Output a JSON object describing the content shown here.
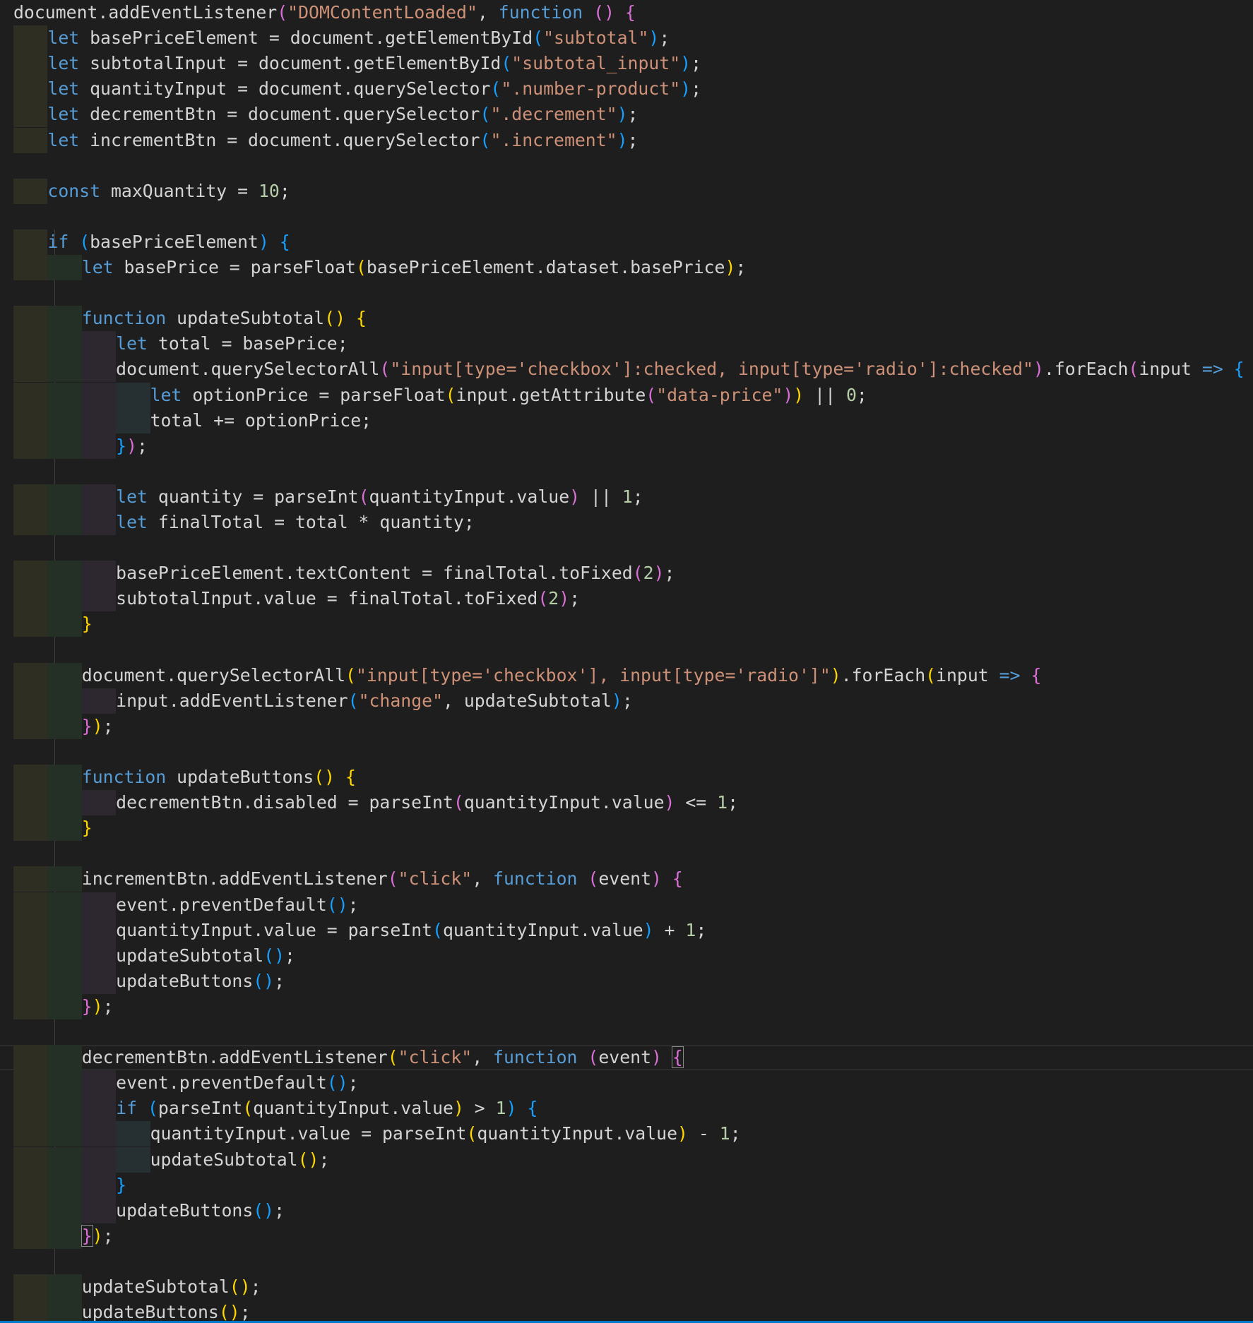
{
  "editor": {
    "language": "javascript",
    "current_line": 41,
    "lines": [
      {
        "indent": 0,
        "tokens": [
          [
            "plain",
            "document.addEventListener"
          ],
          [
            "bracket2",
            "("
          ],
          [
            "string",
            "\"DOMContentLoaded\""
          ],
          [
            "plain",
            ", "
          ],
          [
            "keyword",
            "function"
          ],
          [
            "plain",
            " "
          ],
          [
            "bracket2",
            "()"
          ],
          [
            "plain",
            " "
          ],
          [
            "bracket2",
            "{"
          ]
        ]
      },
      {
        "indent": 1,
        "tokens": [
          [
            "keyword",
            "let"
          ],
          [
            "plain",
            " basePriceElement = document.getElementById"
          ],
          [
            "bracket3",
            "("
          ],
          [
            "string",
            "\"subtotal\""
          ],
          [
            "bracket3",
            ")"
          ],
          [
            "plain",
            ";"
          ]
        ]
      },
      {
        "indent": 1,
        "tokens": [
          [
            "keyword",
            "let"
          ],
          [
            "plain",
            " subtotalInput = document.getElementById"
          ],
          [
            "bracket3",
            "("
          ],
          [
            "string",
            "\"subtotal_input\""
          ],
          [
            "bracket3",
            ")"
          ],
          [
            "plain",
            ";"
          ]
        ]
      },
      {
        "indent": 1,
        "tokens": [
          [
            "keyword",
            "let"
          ],
          [
            "plain",
            " quantityInput = document.querySelector"
          ],
          [
            "bracket3",
            "("
          ],
          [
            "string",
            "\".number-product\""
          ],
          [
            "bracket3",
            ")"
          ],
          [
            "plain",
            ";"
          ]
        ]
      },
      {
        "indent": 1,
        "tokens": [
          [
            "keyword",
            "let"
          ],
          [
            "plain",
            " decrementBtn = document.querySelector"
          ],
          [
            "bracket3",
            "("
          ],
          [
            "string",
            "\".decrement\""
          ],
          [
            "bracket3",
            ")"
          ],
          [
            "plain",
            ";"
          ]
        ]
      },
      {
        "indent": 1,
        "tokens": [
          [
            "keyword",
            "let"
          ],
          [
            "plain",
            " incrementBtn = document.querySelector"
          ],
          [
            "bracket3",
            "("
          ],
          [
            "string",
            "\".increment\""
          ],
          [
            "bracket3",
            ")"
          ],
          [
            "plain",
            ";"
          ]
        ]
      },
      {
        "indent": 0,
        "tokens": []
      },
      {
        "indent": 1,
        "tokens": [
          [
            "keyword",
            "const"
          ],
          [
            "plain",
            " maxQuantity = "
          ],
          [
            "number",
            "10"
          ],
          [
            "plain",
            ";"
          ]
        ]
      },
      {
        "indent": 0,
        "tokens": []
      },
      {
        "indent": 1,
        "tokens": [
          [
            "keyword",
            "if"
          ],
          [
            "plain",
            " "
          ],
          [
            "bracket3",
            "("
          ],
          [
            "plain",
            "basePriceElement"
          ],
          [
            "bracket3",
            ")"
          ],
          [
            "plain",
            " "
          ],
          [
            "bracket3",
            "{"
          ]
        ]
      },
      {
        "indent": 2,
        "tokens": [
          [
            "keyword",
            "let"
          ],
          [
            "plain",
            " basePrice = parseFloat"
          ],
          [
            "bracket1",
            "("
          ],
          [
            "plain",
            "basePriceElement.dataset.basePrice"
          ],
          [
            "bracket1",
            ")"
          ],
          [
            "plain",
            ";"
          ]
        ]
      },
      {
        "indent": 0,
        "tokens": []
      },
      {
        "indent": 2,
        "tokens": [
          [
            "keyword",
            "function"
          ],
          [
            "plain",
            " updateSubtotal"
          ],
          [
            "bracket1",
            "()"
          ],
          [
            "plain",
            " "
          ],
          [
            "bracket1",
            "{"
          ]
        ]
      },
      {
        "indent": 3,
        "tokens": [
          [
            "keyword",
            "let"
          ],
          [
            "plain",
            " total = basePrice;"
          ]
        ]
      },
      {
        "indent": 3,
        "tokens": [
          [
            "plain",
            "document.querySelectorAll"
          ],
          [
            "bracket2",
            "("
          ],
          [
            "string",
            "\"input[type='checkbox']:checked, input[type='radio']:checked\""
          ],
          [
            "bracket2",
            ")"
          ],
          [
            "plain",
            ".forEach"
          ],
          [
            "bracket2",
            "("
          ],
          [
            "plain",
            "input "
          ],
          [
            "keyword",
            "=>"
          ],
          [
            "plain",
            " "
          ],
          [
            "bracket3",
            "{"
          ]
        ]
      },
      {
        "indent": 4,
        "tokens": [
          [
            "keyword",
            "let"
          ],
          [
            "plain",
            " optionPrice = parseFloat"
          ],
          [
            "bracket1",
            "("
          ],
          [
            "plain",
            "input.getAttribute"
          ],
          [
            "bracket2",
            "("
          ],
          [
            "string",
            "\"data-price\""
          ],
          [
            "bracket2",
            ")"
          ],
          [
            "bracket1",
            ")"
          ],
          [
            "plain",
            " || "
          ],
          [
            "number",
            "0"
          ],
          [
            "plain",
            ";"
          ]
        ]
      },
      {
        "indent": 4,
        "tokens": [
          [
            "plain",
            "total += optionPrice;"
          ]
        ]
      },
      {
        "indent": 3,
        "tokens": [
          [
            "bracket3",
            "}"
          ],
          [
            "bracket2",
            ")"
          ],
          [
            "plain",
            ";"
          ]
        ]
      },
      {
        "indent": 0,
        "tokens": []
      },
      {
        "indent": 3,
        "tokens": [
          [
            "keyword",
            "let"
          ],
          [
            "plain",
            " quantity = parseInt"
          ],
          [
            "bracket2",
            "("
          ],
          [
            "plain",
            "quantityInput.value"
          ],
          [
            "bracket2",
            ")"
          ],
          [
            "plain",
            " || "
          ],
          [
            "number",
            "1"
          ],
          [
            "plain",
            ";"
          ]
        ]
      },
      {
        "indent": 3,
        "tokens": [
          [
            "keyword",
            "let"
          ],
          [
            "plain",
            " finalTotal = total * quantity;"
          ]
        ]
      },
      {
        "indent": 0,
        "tokens": []
      },
      {
        "indent": 3,
        "tokens": [
          [
            "plain",
            "basePriceElement.textContent = finalTotal.toFixed"
          ],
          [
            "bracket2",
            "("
          ],
          [
            "number",
            "2"
          ],
          [
            "bracket2",
            ")"
          ],
          [
            "plain",
            ";"
          ]
        ]
      },
      {
        "indent": 3,
        "tokens": [
          [
            "plain",
            "subtotalInput.value = finalTotal.toFixed"
          ],
          [
            "bracket2",
            "("
          ],
          [
            "number",
            "2"
          ],
          [
            "bracket2",
            ")"
          ],
          [
            "plain",
            ";"
          ]
        ]
      },
      {
        "indent": 2,
        "tokens": [
          [
            "bracket1",
            "}"
          ]
        ]
      },
      {
        "indent": 0,
        "tokens": []
      },
      {
        "indent": 2,
        "tokens": [
          [
            "plain",
            "document.querySelectorAll"
          ],
          [
            "bracket1",
            "("
          ],
          [
            "string",
            "\"input[type='checkbox'], input[type='radio']\""
          ],
          [
            "bracket1",
            ")"
          ],
          [
            "plain",
            ".forEach"
          ],
          [
            "bracket1",
            "("
          ],
          [
            "plain",
            "input "
          ],
          [
            "keyword",
            "=>"
          ],
          [
            "plain",
            " "
          ],
          [
            "bracket2",
            "{"
          ]
        ]
      },
      {
        "indent": 3,
        "tokens": [
          [
            "plain",
            "input.addEventListener"
          ],
          [
            "bracket3",
            "("
          ],
          [
            "string",
            "\"change\""
          ],
          [
            "plain",
            ", updateSubtotal"
          ],
          [
            "bracket3",
            ")"
          ],
          [
            "plain",
            ";"
          ]
        ]
      },
      {
        "indent": 2,
        "tokens": [
          [
            "bracket2",
            "}"
          ],
          [
            "bracket1",
            ")"
          ],
          [
            "plain",
            ";"
          ]
        ]
      },
      {
        "indent": 0,
        "tokens": []
      },
      {
        "indent": 2,
        "tokens": [
          [
            "keyword",
            "function"
          ],
          [
            "plain",
            " updateButtons"
          ],
          [
            "bracket1",
            "()"
          ],
          [
            "plain",
            " "
          ],
          [
            "bracket1",
            "{"
          ]
        ]
      },
      {
        "indent": 3,
        "tokens": [
          [
            "plain",
            "decrementBtn.disabled = parseInt"
          ],
          [
            "bracket2",
            "("
          ],
          [
            "plain",
            "quantityInput.value"
          ],
          [
            "bracket2",
            ")"
          ],
          [
            "plain",
            " <= "
          ],
          [
            "number",
            "1"
          ],
          [
            "plain",
            ";"
          ]
        ]
      },
      {
        "indent": 2,
        "tokens": [
          [
            "bracket1",
            "}"
          ]
        ]
      },
      {
        "indent": 0,
        "tokens": []
      },
      {
        "indent": 2,
        "tokens": [
          [
            "plain",
            "incrementBtn.addEventListener"
          ],
          [
            "bracket2",
            "("
          ],
          [
            "string",
            "\"click\""
          ],
          [
            "plain",
            ", "
          ],
          [
            "keyword",
            "function"
          ],
          [
            "plain",
            " "
          ],
          [
            "bracket2",
            "("
          ],
          [
            "plain",
            "event"
          ],
          [
            "bracket2",
            ")"
          ],
          [
            "plain",
            " "
          ],
          [
            "bracket2",
            "{"
          ]
        ]
      },
      {
        "indent": 3,
        "tokens": [
          [
            "plain",
            "event.preventDefault"
          ],
          [
            "bracket3",
            "()"
          ],
          [
            "plain",
            ";"
          ]
        ]
      },
      {
        "indent": 3,
        "tokens": [
          [
            "plain",
            "quantityInput.value = parseInt"
          ],
          [
            "bracket3",
            "("
          ],
          [
            "plain",
            "quantityInput.value"
          ],
          [
            "bracket3",
            ")"
          ],
          [
            "plain",
            " + "
          ],
          [
            "number",
            "1"
          ],
          [
            "plain",
            ";"
          ]
        ]
      },
      {
        "indent": 3,
        "tokens": [
          [
            "plain",
            "updateSubtotal"
          ],
          [
            "bracket3",
            "()"
          ],
          [
            "plain",
            ";"
          ]
        ]
      },
      {
        "indent": 3,
        "tokens": [
          [
            "plain",
            "updateButtons"
          ],
          [
            "bracket3",
            "()"
          ],
          [
            "plain",
            ";"
          ]
        ]
      },
      {
        "indent": 2,
        "tokens": [
          [
            "bracket2",
            "}"
          ],
          [
            "bracket1",
            ")"
          ],
          [
            "plain",
            ";"
          ]
        ]
      },
      {
        "indent": 0,
        "tokens": []
      },
      {
        "indent": 2,
        "tokens": [
          [
            "plain",
            "decrementBtn.addEventListener"
          ],
          [
            "bracket1",
            "("
          ],
          [
            "string",
            "\"click\""
          ],
          [
            "plain",
            ", "
          ],
          [
            "keyword",
            "function"
          ],
          [
            "plain",
            " "
          ],
          [
            "bracket2",
            "("
          ],
          [
            "plain",
            "event"
          ],
          [
            "bracket2",
            ")"
          ],
          [
            "plain",
            " "
          ],
          [
            "bracket2-box",
            "{"
          ]
        ]
      },
      {
        "indent": 3,
        "tokens": [
          [
            "plain",
            "event.preventDefault"
          ],
          [
            "bracket3",
            "()"
          ],
          [
            "plain",
            ";"
          ]
        ]
      },
      {
        "indent": 3,
        "tokens": [
          [
            "keyword",
            "if"
          ],
          [
            "plain",
            " "
          ],
          [
            "bracket3",
            "("
          ],
          [
            "plain",
            "parseInt"
          ],
          [
            "bracket1",
            "("
          ],
          [
            "plain",
            "quantityInput.value"
          ],
          [
            "bracket1",
            ")"
          ],
          [
            "plain",
            " > "
          ],
          [
            "number",
            "1"
          ],
          [
            "bracket3",
            ")"
          ],
          [
            "plain",
            " "
          ],
          [
            "bracket3",
            "{"
          ]
        ]
      },
      {
        "indent": 4,
        "tokens": [
          [
            "plain",
            "quantityInput.value = parseInt"
          ],
          [
            "bracket1",
            "("
          ],
          [
            "plain",
            "quantityInput.value"
          ],
          [
            "bracket1",
            ")"
          ],
          [
            "plain",
            " - "
          ],
          [
            "number",
            "1"
          ],
          [
            "plain",
            ";"
          ]
        ]
      },
      {
        "indent": 4,
        "tokens": [
          [
            "plain",
            "updateSubtotal"
          ],
          [
            "bracket1",
            "()"
          ],
          [
            "plain",
            ";"
          ]
        ]
      },
      {
        "indent": 3,
        "tokens": [
          [
            "bracket3",
            "}"
          ]
        ]
      },
      {
        "indent": 3,
        "tokens": [
          [
            "plain",
            "updateButtons"
          ],
          [
            "bracket3",
            "()"
          ],
          [
            "plain",
            ";"
          ]
        ]
      },
      {
        "indent": 2,
        "tokens": [
          [
            "bracket2-box",
            "}"
          ],
          [
            "bracket1",
            ")"
          ],
          [
            "plain",
            ";"
          ]
        ]
      },
      {
        "indent": 0,
        "tokens": []
      },
      {
        "indent": 2,
        "tokens": [
          [
            "plain",
            "updateSubtotal"
          ],
          [
            "bracket1",
            "()"
          ],
          [
            "plain",
            ";"
          ]
        ]
      },
      {
        "indent": 2,
        "tokens": [
          [
            "plain",
            "updateButtons"
          ],
          [
            "bracket1",
            "()"
          ],
          [
            "plain",
            ";"
          ]
        ]
      }
    ]
  }
}
